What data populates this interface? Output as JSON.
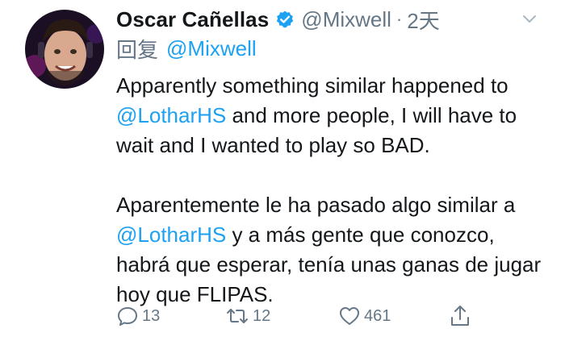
{
  "tweet": {
    "display_name": "Oscar Cañellas",
    "handle": "@Mixwell",
    "separator": "·",
    "time": "2天",
    "reply_label": "回复",
    "reply_to": "@Mixwell",
    "paragraph1": {
      "line1": "Apparently something similar happened to",
      "mention": "@LotharHS",
      "after_mention": " and more people, I will have to wait and I wanted to play so BAD."
    },
    "paragraph2": {
      "line1": "Aparentemente le ha pasado algo similar a",
      "mention": "@LotharHS",
      "after_mention": " y a más gente que conozco, habrá que esperar, tenía unas ganas de jugar hoy que FLIPAS."
    },
    "actions": {
      "reply_count": "13",
      "retweet_count": "12",
      "like_count": "461"
    }
  },
  "icons": {
    "verified": "verified-badge-icon",
    "menu": "chevron-down-icon",
    "reply": "reply-icon",
    "retweet": "retweet-icon",
    "like": "heart-icon",
    "share": "share-icon"
  },
  "colors": {
    "text": "#14171a",
    "secondary": "#657786",
    "link": "#1da1f2",
    "verified": "#1da1f2"
  }
}
